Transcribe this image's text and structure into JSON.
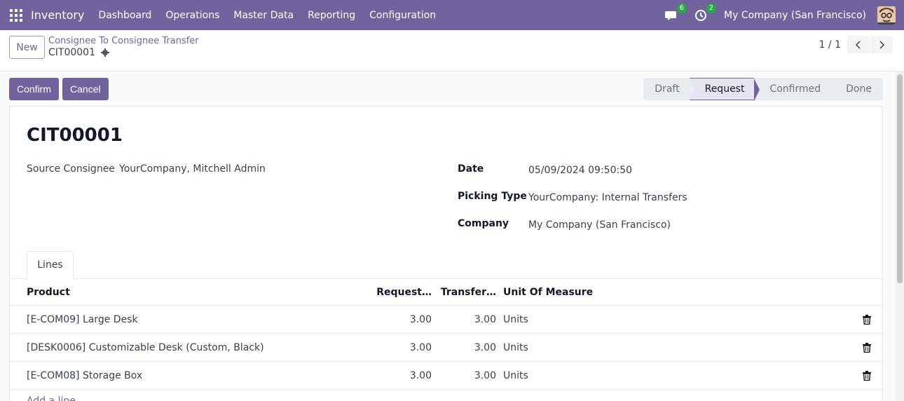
{
  "navbar": {
    "app_name": "Inventory",
    "menu": [
      "Dashboard",
      "Operations",
      "Master Data",
      "Reporting",
      "Configuration"
    ],
    "messages_count": "6",
    "activities_count": "2",
    "company": "My Company (San Francisco)"
  },
  "control": {
    "new_label": "New",
    "breadcrumb": "Consignee To Consignee Transfer",
    "record_ref": "CIT00001",
    "pager": "1 / 1"
  },
  "actions": {
    "confirm_label": "Confirm",
    "cancel_label": "Cancel"
  },
  "statusbar": {
    "stages": [
      "Draft",
      "Request",
      "Confirmed",
      "Done"
    ],
    "active": "Request"
  },
  "form": {
    "title": "CIT00001",
    "source_consignee_label": "Source Consignee",
    "source_consignee_value": "YourCompany, Mitchell Admin",
    "date_label": "Date",
    "date_value": "05/09/2024 09:50:50",
    "picking_type_label": "Picking Type",
    "picking_type_value": "YourCompany: Internal Transfers",
    "company_label": "Company",
    "company_value": "My Company (San Francisco)"
  },
  "tabs": [
    "Lines"
  ],
  "lines": {
    "headers": {
      "product": "Product",
      "requested": "Request…",
      "transferred": "Transfer…",
      "uom": "Unit Of Measure"
    },
    "rows": [
      {
        "product": "[E-COM09] Large Desk",
        "requested": "3.00",
        "transferred": "3.00",
        "uom": "Units"
      },
      {
        "product": "[DESK0006] Customizable Desk (Custom, Black)",
        "requested": "3.00",
        "transferred": "3.00",
        "uom": "Units"
      },
      {
        "product": "[E-COM08] Storage Box",
        "requested": "3.00",
        "transferred": "3.00",
        "uom": "Units"
      }
    ],
    "add_line_label": "Add a line"
  },
  "colors": {
    "brand": "#71639e",
    "badge": "#28a745"
  }
}
